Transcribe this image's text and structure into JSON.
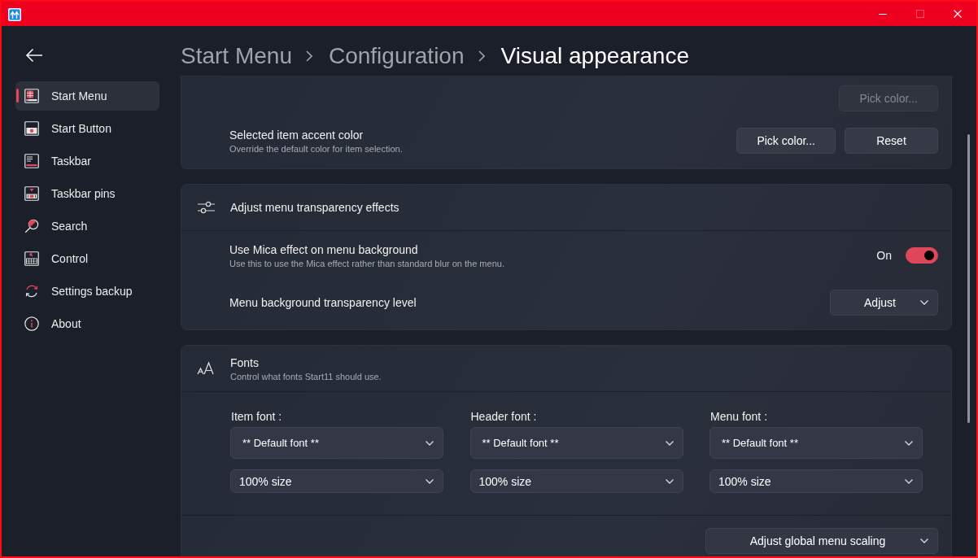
{
  "window": {
    "controls": [
      {
        "kind": "minimize",
        "disabled": false
      },
      {
        "kind": "maximize",
        "disabled": true
      },
      {
        "kind": "close",
        "disabled": false
      }
    ]
  },
  "sidebar": {
    "items": [
      {
        "label": "Start Menu",
        "selected": true
      },
      {
        "label": "Start Button",
        "selected": false
      },
      {
        "label": "Taskbar",
        "selected": false
      },
      {
        "label": "Taskbar pins",
        "selected": false
      },
      {
        "label": "Search",
        "selected": false
      },
      {
        "label": "Control",
        "selected": false
      },
      {
        "label": "Settings backup",
        "selected": false
      },
      {
        "label": "About",
        "selected": false
      }
    ]
  },
  "breadcrumb": [
    {
      "label": "Start Menu",
      "selected": false
    },
    {
      "label": "Configuration",
      "selected": false
    },
    {
      "label": "Visual appearance",
      "selected": true
    }
  ],
  "sections": [
    {
      "rows": [
        {
          "kind": "buttons",
          "buttons": [
            {
              "label": "Pick color...",
              "disabled": true
            }
          ]
        },
        {
          "kind": "buttons",
          "title": "Selected item accent color",
          "description": "Override the default color for item selection.",
          "buttons": [
            {
              "label": "Pick color...",
              "disabled": false
            },
            {
              "label": "Reset",
              "disabled": false
            }
          ]
        }
      ]
    },
    {
      "header": {
        "title": "Adjust menu transparency effects"
      },
      "rows": [
        {
          "kind": "toggle",
          "title": "Use Mica effect on menu background",
          "description": "Use this to use the Mica effect rather than standard blur on the menu.",
          "toggle": {
            "on": true,
            "label": "On"
          }
        },
        {
          "kind": "dropdown",
          "title": "Menu background transparency level",
          "dropdown": {
            "label": "Adjust"
          }
        }
      ]
    },
    {
      "header": {
        "title": "Fonts",
        "description": "Control what fonts Start11 should use."
      },
      "rows": [
        {
          "kind": "font_columns",
          "columns": [
            {
              "label": "Item font :",
              "font": "** Default font **",
              "size": "100% size"
            },
            {
              "label": "Header font :",
              "font": "** Default font **",
              "size": "100% size"
            },
            {
              "label": "Menu font :",
              "font": "** Default font **",
              "size": "100% size"
            }
          ]
        },
        {
          "kind": "dropdown",
          "dropdown": {
            "label": "Adjust global menu scaling"
          }
        }
      ]
    }
  ]
}
